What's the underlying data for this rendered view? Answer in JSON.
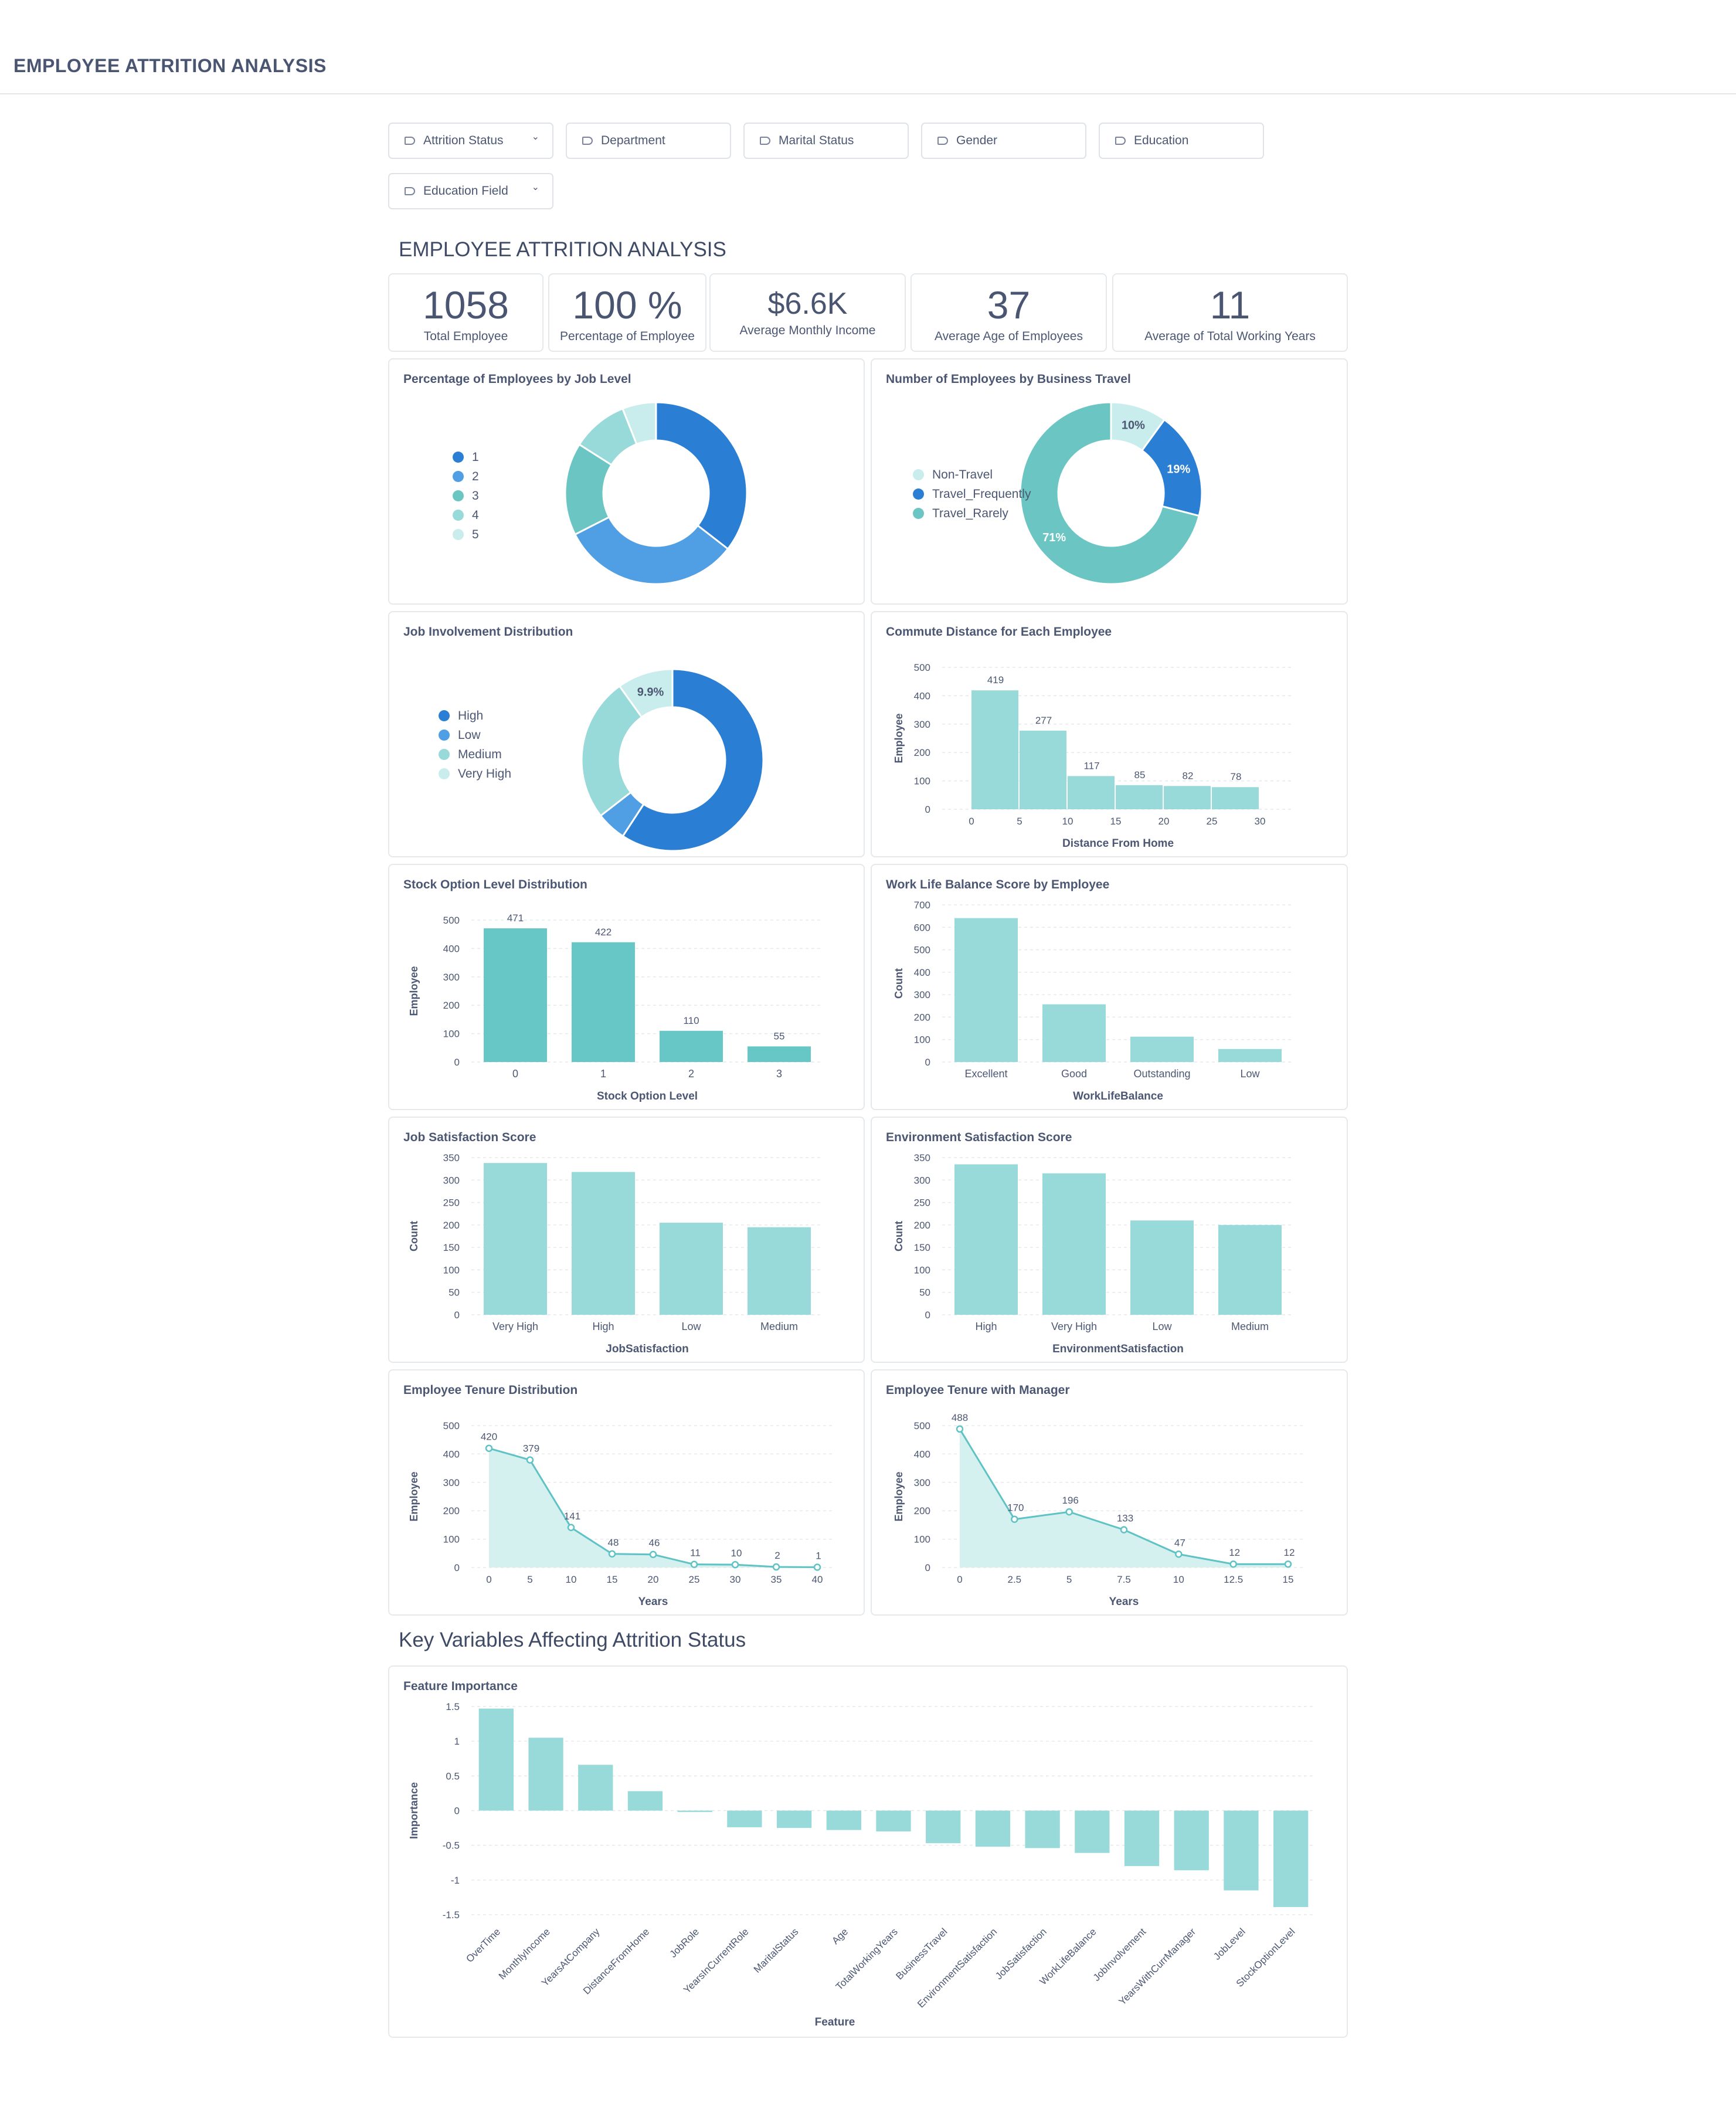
{
  "header": {
    "title": "EMPLOYEE ATTRITION ANALYSIS"
  },
  "filters": [
    {
      "label": "Attrition Status",
      "chevron": "⌄"
    },
    {
      "label": "Department"
    },
    {
      "label": "Marital Status"
    },
    {
      "label": "Gender"
    },
    {
      "label": "Education"
    },
    {
      "label": "Education Field",
      "chevron": "⌄"
    }
  ],
  "dashboard": {
    "title": "EMPLOYEE ATTRITION ANALYSIS",
    "key_title": "Key Variables Affecting Attrition Status"
  },
  "kpis": [
    {
      "value": "1058",
      "label": "Total Employee"
    },
    {
      "value": "100 %",
      "label": "Percentage of Employee"
    },
    {
      "value": "$6.6K",
      "label": "Average Monthly Income"
    },
    {
      "value": "37",
      "label": "Average Age of Employees"
    },
    {
      "value": "11",
      "label": "Average of Total Working Years"
    }
  ],
  "colors": {
    "bar": "#98dad9",
    "bar_dark": "#67c7c6",
    "blue_dark": "#2a7fd4",
    "blue_mid": "#509ee3",
    "teal": "#6bc6c3",
    "teal_light": "#98dad9",
    "pale": "#c9ecec",
    "line": "#5fc2c4",
    "area": "#d4f0ef"
  },
  "cards": {
    "job_level": {
      "title": "Percentage of Employees by Job Level"
    },
    "business_travel": {
      "title": "Number of Employees by Business Travel"
    },
    "job_involvement": {
      "title": "Job Involvement Distribution"
    },
    "commute": {
      "title": "Commute Distance for Each Employee"
    },
    "stock": {
      "title": "Stock Option Level Distribution"
    },
    "wlb": {
      "title": "Work Life Balance Score by Employee"
    },
    "job_sat": {
      "title": "Job Satisfaction Score"
    },
    "env_sat": {
      "title": "Environment Satisfaction Score"
    },
    "tenure": {
      "title": "Employee Tenure Distribution"
    },
    "tenure_mgr": {
      "title": "Employee Tenure with Manager"
    },
    "importance": {
      "title": "Feature Importance"
    }
  },
  "chart_data": [
    {
      "id": "job_level",
      "type": "pie",
      "categories": [
        "1",
        "2",
        "3",
        "4",
        "5"
      ],
      "values": [
        35.5,
        32.0,
        16.5,
        10.0,
        6.0
      ],
      "colors": [
        "#2a7fd4",
        "#509ee3",
        "#6bc6c3",
        "#98dad9",
        "#c9ecec"
      ],
      "legend": "left"
    },
    {
      "id": "business_travel",
      "type": "pie",
      "categories": [
        "Non-Travel",
        "Travel_Frequently",
        "Travel_Rarely"
      ],
      "values": [
        10,
        19,
        71
      ],
      "labels": [
        "10%",
        "19%",
        "71%"
      ],
      "colors": [
        "#c9ecec",
        "#2a7fd4",
        "#6bc6c3"
      ],
      "legend": "left"
    },
    {
      "id": "job_involvement",
      "type": "pie",
      "categories": [
        "High",
        "Low",
        "Medium",
        "Very High"
      ],
      "values": [
        59.2,
        5.3,
        25.6,
        9.9
      ],
      "labels": [
        "",
        "",
        "",
        "9.9%"
      ],
      "colors": [
        "#2a7fd4",
        "#509ee3",
        "#98dad9",
        "#c9ecec"
      ],
      "legend": "left"
    },
    {
      "id": "commute",
      "type": "bar",
      "x": [
        0,
        5,
        10,
        15,
        20,
        25
      ],
      "values": [
        419,
        277,
        117,
        85,
        82,
        78
      ],
      "xticks": [
        "0",
        "5",
        "10",
        "15",
        "20",
        "25",
        "30"
      ],
      "yticks": [
        "0",
        "100",
        "200",
        "300",
        "400",
        "500"
      ],
      "xlabel": "Distance From Home",
      "ylabel": "Employee",
      "ylim": [
        0,
        500
      ]
    },
    {
      "id": "stock",
      "type": "bar",
      "categories": [
        "0",
        "1",
        "2",
        "3"
      ],
      "values": [
        471,
        422,
        110,
        55
      ],
      "yticks": [
        "0",
        "100",
        "200",
        "300",
        "400",
        "500"
      ],
      "xlabel": "Stock Option Level",
      "ylabel": "Employee",
      "ylim": [
        0,
        500
      ]
    },
    {
      "id": "wlb",
      "type": "bar",
      "categories": [
        "Excellent",
        "Good",
        "Outstanding",
        "Low"
      ],
      "values": [
        641,
        257,
        113,
        58
      ],
      "yticks": [
        "0",
        "100",
        "200",
        "300",
        "400",
        "500",
        "600",
        "700"
      ],
      "xlabel": "WorkLifeBalance",
      "ylabel": "Count",
      "ylim": [
        0,
        700
      ]
    },
    {
      "id": "job_sat",
      "type": "bar",
      "categories": [
        "Very High",
        "High",
        "Low",
        "Medium"
      ],
      "values": [
        338,
        318,
        205,
        195
      ],
      "yticks": [
        "0",
        "50",
        "100",
        "150",
        "200",
        "250",
        "300",
        "350"
      ],
      "xlabel": "JobSatisfaction",
      "ylabel": "Count",
      "ylim": [
        0,
        350
      ]
    },
    {
      "id": "env_sat",
      "type": "bar",
      "categories": [
        "High",
        "Very High",
        "Low",
        "Medium"
      ],
      "values": [
        335,
        315,
        210,
        200
      ],
      "yticks": [
        "0",
        "50",
        "100",
        "150",
        "200",
        "250",
        "300",
        "350"
      ],
      "xlabel": "EnvironmentSatisfaction",
      "ylabel": "Count",
      "ylim": [
        0,
        350
      ]
    },
    {
      "id": "tenure",
      "type": "area",
      "x": [
        0,
        5,
        10,
        15,
        20,
        25,
        30,
        35,
        40
      ],
      "values": [
        420,
        379,
        141,
        48,
        46,
        11,
        10,
        2,
        1
      ],
      "xticks": [
        "0",
        "5",
        "10",
        "15",
        "20",
        "25",
        "30",
        "35",
        "40"
      ],
      "yticks": [
        "0",
        "100",
        "200",
        "300",
        "400",
        "500"
      ],
      "xlabel": "Years",
      "ylabel": "Employee",
      "xlim": [
        0,
        40
      ],
      "ylim": [
        0,
        500
      ]
    },
    {
      "id": "tenure_mgr",
      "type": "area",
      "x": [
        0,
        2.5,
        5,
        7.5,
        10,
        12.5,
        15
      ],
      "values": [
        488,
        170,
        196,
        133,
        47,
        12,
        12
      ],
      "xticks": [
        "0",
        "2.5",
        "5",
        "7.5",
        "10",
        "12.5",
        "15"
      ],
      "yticks": [
        "0",
        "100",
        "200",
        "300",
        "400",
        "500"
      ],
      "xlabel": "Years",
      "ylabel": "Employee",
      "xlim": [
        0,
        15
      ],
      "ylim": [
        0,
        500
      ]
    },
    {
      "id": "importance",
      "type": "bar",
      "categories": [
        "OverTime",
        "MonthlyIncome",
        "YearsAtCompany",
        "DistanceFromHome",
        "JobRole",
        "YearsInCurrentRole",
        "MaritalStatus",
        "Age",
        "TotalWorkingYears",
        "BusinessTravel",
        "EnvironmentSatisfaction",
        "JobSatisfaction",
        "WorkLifeBalance",
        "JobInvolvement",
        "YearsWithCurrManager",
        "JobLevel",
        "StockOptionLevel"
      ],
      "values": [
        1.47,
        1.05,
        0.66,
        0.28,
        -0.02,
        -0.24,
        -0.25,
        -0.28,
        -0.3,
        -0.47,
        -0.52,
        -0.54,
        -0.61,
        -0.8,
        -0.86,
        -1.15,
        -1.39
      ],
      "yticks": [
        "-1.5",
        "-1",
        "-0.5",
        "0",
        "0.5",
        "1",
        "1.5"
      ],
      "xlabel": "Feature",
      "ylabel": "Importance",
      "ylim": [
        -1.5,
        1.5
      ]
    }
  ]
}
